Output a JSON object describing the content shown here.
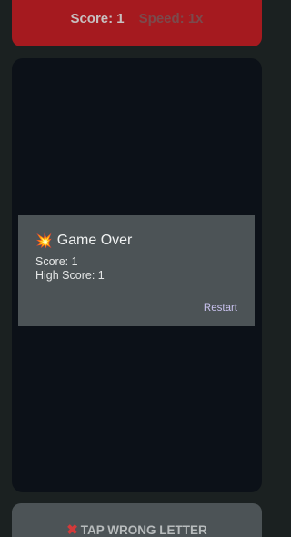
{
  "top_bar": {
    "score_text": "Score: 1",
    "speed_text": "Speed: 1x",
    "color": "#a51a1f"
  },
  "dialog": {
    "icon": "collision-icon",
    "icon_glyph": "💥",
    "title": "Game Over",
    "score_line": "Score: 1",
    "high_score_line": "High Score: 1",
    "restart_label": "Restart"
  },
  "bottom_button": {
    "icon": "cross-mark-icon",
    "icon_glyph": "✖",
    "label": "TAP WRONG LETTER"
  }
}
